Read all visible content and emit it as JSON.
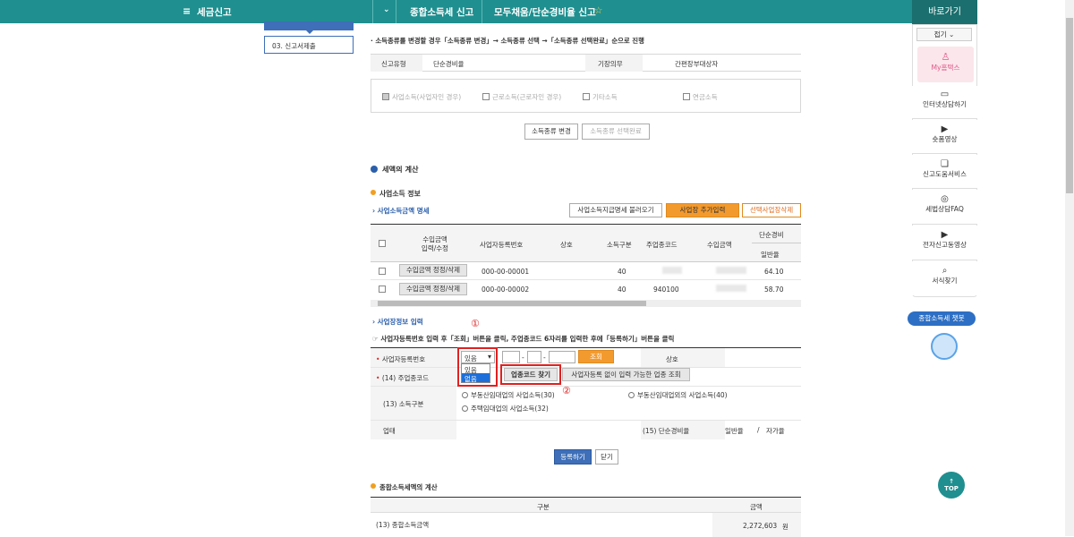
{
  "topbar": {
    "menu": "세금신고",
    "crumb1": "종합소득세 신고",
    "crumb2": "모두채움/단순경비율 신고",
    "star": "☆"
  },
  "left": {
    "prev": "",
    "step": "03. 신고서제출"
  },
  "intro": "· 소득종류를 변경할 경우「소득종류 변경」→ 소득종류 선택 →「소득종류 선택완료」순으로 진행",
  "report": {
    "type_label": "신고유형",
    "type_value": "단순경비율",
    "book_label": "기장의무",
    "book_value": "간편장부대상자"
  },
  "income_types": [
    "사업소득(사업자인 경우)",
    "근로소득(근로자인 경우)",
    "기타소득",
    "연금소득"
  ],
  "buttons": {
    "change": "소득종류 변경",
    "complete": "소득종류 선택완료",
    "load": "사업소득지급명세 불러오기",
    "add": "사업장 추가입력",
    "delete": "선택사업장삭제",
    "find_code": "업종코드 찾기",
    "lookup": "사업자등록 없이 입력 가능한 업종 조회",
    "query": "조회",
    "register": "등록하기",
    "close": "닫기",
    "top": "TOP"
  },
  "sections": {
    "calc": "세액의 계산",
    "biz_info": "사업소득 정보",
    "biz_amount": "사업소득금액 명세",
    "biz_input": "사업장정보 입력",
    "total": "종합소득세액의 계산"
  },
  "table": {
    "headers": [
      "수입금액\n입력/수정",
      "사업자등록번호",
      "상호",
      "소득구분",
      "주업종코드",
      "수입금액",
      "단순경비",
      "일반율"
    ],
    "rows": [
      {
        "btn": "수입금액 정정/삭제",
        "reg": "000-00-00001",
        "kind": "40",
        "code": "",
        "rate": "64.10"
      },
      {
        "btn": "수입금액 정정/삭제",
        "reg": "000-00-00002",
        "kind": "40",
        "code": "940100",
        "rate": "58.70"
      }
    ]
  },
  "instruction": "☞ 사업자등록번호 입력 후「조회」버튼을 클릭, 주업종코드 6자리를 입력한 후에「등록하기」버튼을 클릭",
  "form": {
    "reg_label": "사업자등록번호",
    "select_value": "있음",
    "options": [
      "있음",
      "없음"
    ],
    "dash": "-",
    "trade_label": "상호",
    "code_label": "(14) 주업종코드",
    "income_label": "(13) 소득구분",
    "status_label": "업태",
    "rate_label": "(15) 단순경비율",
    "rate_general": "일반율",
    "rate_slash": "/",
    "rate_own": "자가율",
    "radios": [
      "부동산임대업의 사업소득(30)",
      "부동산임대업외의 사업소득(40)",
      "주택임대업의 사업소득(32)"
    ]
  },
  "marks": {
    "one": "①",
    "two": "②"
  },
  "total_table": {
    "h1": "구분",
    "h2": "금액",
    "row_label": "(13) 종합소득금액",
    "row_value": "2,272,603",
    "unit": "원"
  },
  "right": {
    "title": "바로가기",
    "fold": "접기",
    "items": [
      "My홈택스",
      "인터넷상담하기",
      "숏폼영상",
      "신고도움서비스",
      "세법상담FAQ",
      "전자신고동영상",
      "서식찾기"
    ],
    "chatbot": "종합소득세 챗봇"
  }
}
